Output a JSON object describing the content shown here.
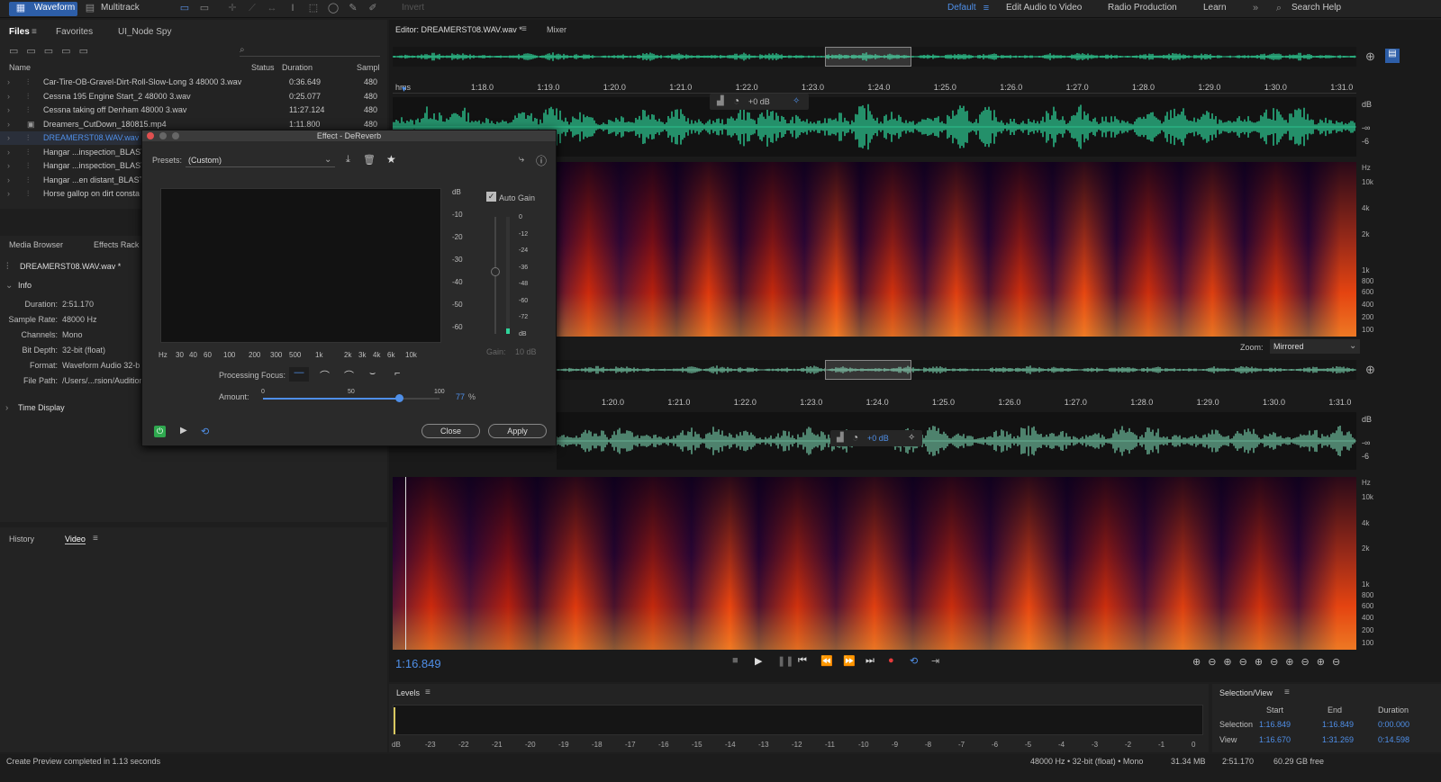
{
  "topbar": {
    "waveform": "Waveform",
    "multitrack": "Multitrack",
    "invert": "Invert",
    "workspace_default": "Default",
    "ws_edit_video": "Edit Audio to Video",
    "ws_radio": "Radio Production",
    "ws_learn": "Learn",
    "search_placeholder": "Search Help"
  },
  "files_panel": {
    "tabs": [
      "Files",
      "Favorites",
      "UI_Node Spy"
    ],
    "columns": {
      "name": "Name",
      "status": "Status",
      "duration": "Duration",
      "sample": "Sampl"
    },
    "rows": [
      {
        "name": "Car-Tire-OB-Gravel-Dirt-Roll-Slow-Long 3 48000 3.wav",
        "duration": "0:36.649",
        "sample": "480"
      },
      {
        "name": "Cessna 195 Engine Start_2 48000 3.wav",
        "duration": "0:25.077",
        "sample": "480"
      },
      {
        "name": "Cessna taking off Denham 48000 3.wav",
        "duration": "11:27.124",
        "sample": "480"
      },
      {
        "name": "Dreamers_CutDown_180815.mp4",
        "duration": "1:11.800",
        "sample": "480"
      },
      {
        "name": "DREAMERST08.WAV.wav *",
        "duration": "",
        "sample": ""
      },
      {
        "name": "Hangar ...inspection_BLAST",
        "duration": "",
        "sample": ""
      },
      {
        "name": "Hangar ...inspection_BLAST",
        "duration": "",
        "sample": ""
      },
      {
        "name": "Hangar ...en distant_BLAST",
        "duration": "",
        "sample": ""
      },
      {
        "name": "Horse gallop on dirt consta",
        "duration": "",
        "sample": ""
      }
    ]
  },
  "media_panel": {
    "tabs": [
      "Media Browser",
      "Effects Rack"
    ],
    "file": "DREAMERST08.WAV.wav *",
    "info_label": "Info",
    "info": [
      {
        "k": "Duration:",
        "v": "2:51.170"
      },
      {
        "k": "Sample Rate:",
        "v": "48000 Hz"
      },
      {
        "k": "Channels:",
        "v": "Mono"
      },
      {
        "k": "Bit Depth:",
        "v": "32-bit (float)"
      },
      {
        "k": "Format:",
        "v": "Waveform Audio 32-b"
      },
      {
        "k": "File Path:",
        "v": "/Users/...rsion/Audition"
      }
    ],
    "time_display": "Time Display"
  },
  "history_panel": {
    "tabs": [
      "History",
      "Video"
    ]
  },
  "editor": {
    "tab": "Editor: DREAMERST08.WAV.wav *",
    "mixer": "Mixer",
    "ruler_unit": "hms",
    "ruler": [
      "1:18.0",
      "1:19.0",
      "1:20.0",
      "1:21.0",
      "1:22.0",
      "1:23.0",
      "1:24.0",
      "1:25.0",
      "1:26.0",
      "1:27.0",
      "1:28.0",
      "1:29.0",
      "1:30.0",
      "1:31.0"
    ],
    "ruler2": [
      "1:20.0",
      "1:21.0",
      "1:22.0",
      "1:23.0",
      "1:24.0",
      "1:25.0",
      "1:26.0",
      "1:27.0",
      "1:28.0",
      "1:29.0",
      "1:30.0",
      "1:31.0"
    ],
    "gain": "+0 dB",
    "db_scale": [
      "dB",
      "-∞",
      "-6"
    ],
    "hz_scale": [
      "Hz",
      "10k",
      "4k",
      "2k",
      "1k",
      "800",
      "600",
      "400",
      "200",
      "100"
    ],
    "zoom_label": "Zoom:",
    "zoom_value": "Mirrored",
    "current_time": "1:16.849"
  },
  "dialog": {
    "title": "Effect - DeReverb",
    "presets_label": "Presets:",
    "preset_value": "(Custom)",
    "graph_db": [
      "dB",
      "-10",
      "-20",
      "-30",
      "-40",
      "-50",
      "-60"
    ],
    "graph_hz": [
      "Hz",
      "30",
      "40",
      "60",
      "100",
      "200",
      "300",
      "500",
      "1k",
      "2k",
      "3k",
      "4k",
      "6k",
      "10k"
    ],
    "auto_gain": "Auto Gain",
    "meter_scale": [
      "0",
      "-12",
      "-24",
      "-36",
      "-48",
      "-60",
      "-72",
      "dB"
    ],
    "gain_label": "Gain:",
    "gain_value": "10 dB",
    "processing_focus": "Processing Focus:",
    "amount_label": "Amount:",
    "amount_ticks": [
      "0",
      "50",
      "100"
    ],
    "amount_value": "77",
    "amount_unit": "%",
    "amount_fraction": 0.77,
    "close": "Close",
    "apply": "Apply"
  },
  "levels": {
    "title": "Levels",
    "scale": [
      "dB",
      "-23",
      "-22",
      "-21",
      "-20",
      "-19",
      "-18",
      "-17",
      "-16",
      "-15",
      "-14",
      "-13",
      "-12",
      "-11",
      "-10",
      "-9",
      "-8",
      "-7",
      "-6",
      "-5",
      "-4",
      "-3",
      "-2",
      "-1",
      "0"
    ]
  },
  "selection": {
    "title": "Selection/View",
    "headers": [
      "Start",
      "End",
      "Duration"
    ],
    "rows": [
      {
        "label": "Selection",
        "start": "1:16.849",
        "end": "1:16.849",
        "duration": "0:00.000"
      },
      {
        "label": "View",
        "start": "1:16.670",
        "end": "1:31.269",
        "duration": "0:14.598"
      }
    ]
  },
  "status": {
    "message": "Create Preview completed in 1.13 seconds",
    "format": "48000 Hz • 32-bit (float) • Mono",
    "size": "31.34 MB",
    "duration": "2:51.170",
    "free": "60.29 GB free"
  },
  "colors": {
    "accent": "#4f8fe8",
    "waveform": "#2fd49a",
    "waveform_dim": "#6fbf9f",
    "record": "#e53b3b"
  }
}
